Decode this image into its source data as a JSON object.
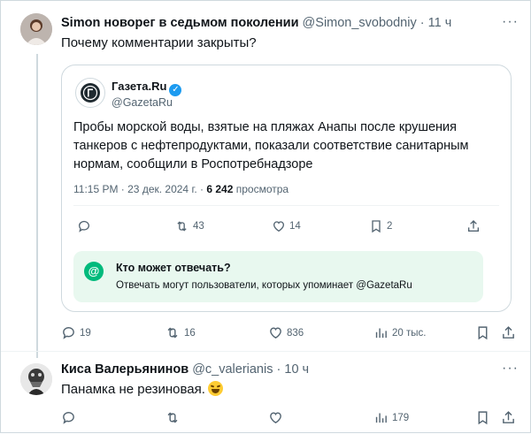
{
  "post1": {
    "author_name": "Simon новорег в седьмом поколении",
    "handle": "@Simon_svobodniy",
    "time": "11 ч",
    "text": "Почему комментарии закрыты?",
    "stats": {
      "replies": "19",
      "reposts": "16",
      "likes": "836",
      "views": "20 тыс."
    }
  },
  "quote": {
    "author_name": "Газета.Ru",
    "handle": "@GazetaRu",
    "text_lines": [
      "Пробы морской воды, взятые на пляжах Анапы после крушения",
      "танкеров с нефтепродуктами, показали соответствие санитарным",
      "нормам, сообщили в Роспотребнадзоре"
    ],
    "time": "11:15 PM · 23 дек. 2024 г. · ",
    "views_count": "6 242",
    "views_label": "просмотра",
    "stats": {
      "reposts": "43",
      "likes": "14",
      "bookmarks": "2"
    },
    "reply_restriction": {
      "title": "Кто может отвечать?",
      "description": "Отвечать могут пользователи, которых упоминает @GazetaRu"
    }
  },
  "post2": {
    "author_name": "Киса Валерьянинов",
    "handle": "@c_valerianis",
    "time": "10 ч",
    "text": "Панамка не резиновая.",
    "stats": {
      "views": "179"
    }
  },
  "icons": [
    "more-icon",
    "reply-icon",
    "repost-icon",
    "like-icon",
    "views-icon",
    "bookmark-icon",
    "share-icon",
    "verified-icon",
    "mention-icon",
    "laughing-emoji"
  ],
  "colors": {
    "text": "#0f1419",
    "secondary": "#536471",
    "border": "#cfd9de",
    "verified": "#1d9bf0",
    "reply_box_bg": "#e8f8ef",
    "reply_icon": "#00ba7c"
  }
}
